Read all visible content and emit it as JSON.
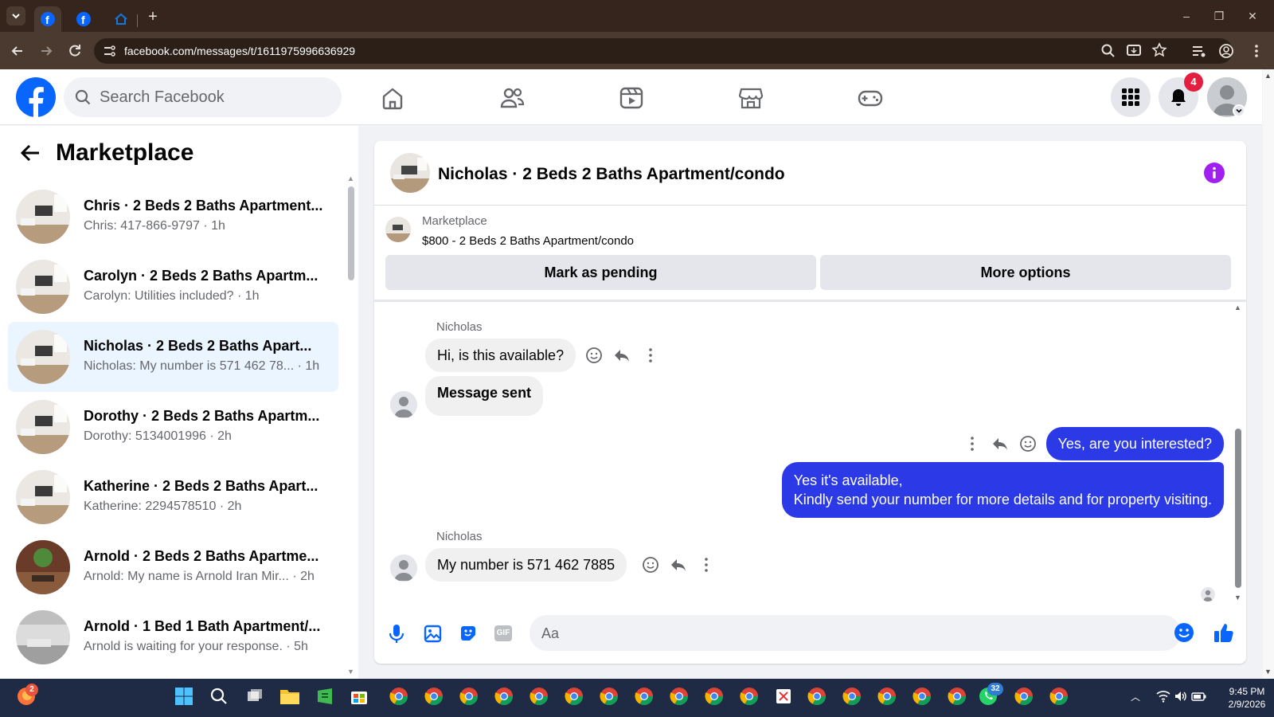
{
  "browser": {
    "url": "facebook.com/messages/t/1611975996636929",
    "new_tab_symbol": "+"
  },
  "header": {
    "search_placeholder": "Search Facebook",
    "notification_count": "4",
    "nav_icons": [
      "home-icon",
      "friends-icon",
      "video-icon",
      "marketplace-icon",
      "gaming-icon"
    ],
    "brand_color": "#0866ff"
  },
  "sidebar": {
    "title": "Marketplace",
    "conversations": [
      {
        "title": "Chris · 2 Beds 2 Baths Apartment...",
        "preview": "Chris: 417-866-9797 · 1h",
        "selected": false
      },
      {
        "title": "Carolyn · 2 Beds 2 Baths Apartm...",
        "preview": "Carolyn: Utilities included? · 1h",
        "selected": false
      },
      {
        "title": "Nicholas · 2 Beds 2 Baths Apart...",
        "preview": "Nicholas: My number is 571 462 78... · 1h",
        "selected": true
      },
      {
        "title": "Dorothy · 2 Beds 2 Baths Apartm...",
        "preview": "Dorothy: 5134001996 · 2h",
        "selected": false
      },
      {
        "title": "Katherine · 2 Beds 2 Baths Apart...",
        "preview": "Katherine: 2294578510 · 2h",
        "selected": false
      },
      {
        "title": "Arnold · 2 Beds 2 Baths Apartme...",
        "preview": "Arnold: My name is Arnold Iran Mir... · 2h",
        "selected": false
      },
      {
        "title": "Arnold · 1 Bed 1 Bath Apartment/...",
        "preview": "Arnold is waiting for your response. · 5h",
        "selected": false
      }
    ]
  },
  "chat": {
    "title": "Nicholas · 2 Beds 2 Baths Apartment/condo",
    "listing_source": "Marketplace",
    "listing": "$800 - 2 Beds 2 Baths Apartment/condo",
    "mark_pending": "Mark as pending",
    "more_options": "More options",
    "messages": [
      {
        "sender": "Nicholas",
        "text": "Hi, is this available?",
        "direction": "in"
      },
      {
        "text": "Message sent",
        "direction": "in"
      },
      {
        "text": "Yes, are you interested?",
        "direction": "out"
      },
      {
        "line1": "Yes it's available,",
        "line2": "Kindly send your number for more details and for property visiting.",
        "direction": "out"
      },
      {
        "sender": "Nicholas",
        "text": "My number is 571 462 7885",
        "direction": "in"
      }
    ],
    "composer_placeholder": "Aa",
    "accent_color": "#2b3ae6"
  },
  "taskbar": {
    "time": "9:45 PM",
    "date": "2/9/2026",
    "firefox_badge": "2",
    "whatsapp_badge": "32"
  }
}
